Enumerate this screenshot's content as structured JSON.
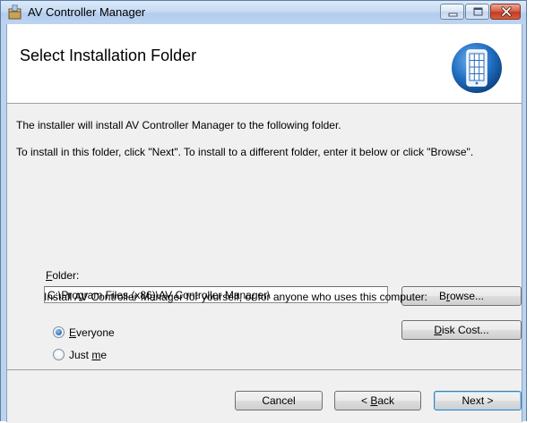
{
  "window": {
    "title": "AV Controller Manager"
  },
  "banner": {
    "title": "Select Installation Folder"
  },
  "body": {
    "line1": "The installer will install AV Controller Manager to the following folder.",
    "line2": "To install in this folder, click \"Next\". To install to a different folder, enter it below or click \"Browse\".",
    "folder_label_prefix": "",
    "folder_label_accel": "F",
    "folder_label_rest": "older:",
    "folder_value": "C:\\Program Files (x86)\\AV Controller Manager\\",
    "browse_prefix": "B",
    "browse_accel": "r",
    "browse_rest": "owse...",
    "diskcost_accel": "D",
    "diskcost_rest": "isk Cost...",
    "install_for": "Install AV Controller Manager for yourself, or for anyone who uses this computer:",
    "radio_everyone_accel": "E",
    "radio_everyone_rest": "veryone",
    "radio_justme_prefix": "Just ",
    "radio_justme_accel": "m",
    "radio_justme_rest": "e",
    "selected_option": "Everyone"
  },
  "footer": {
    "cancel_label": "Cancel",
    "back_prefix": "< ",
    "back_accel": "B",
    "back_rest": "ack",
    "next_label": "Next >"
  },
  "colors": {
    "titlebar": "#c6dbf3",
    "close_button": "#c53a20",
    "default_button_border": "#3c7fb1",
    "logo_blue": "#1e6cc0"
  },
  "icons": {
    "app": "installer-box-icon",
    "logo": "remote-controller-icon",
    "minimize": "minimize-icon",
    "maximize": "maximize-icon",
    "close": "close-icon"
  }
}
